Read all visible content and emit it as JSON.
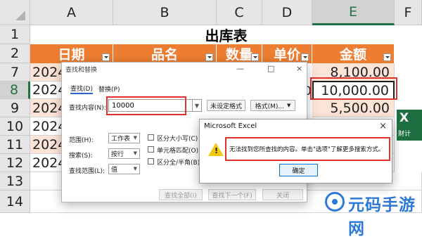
{
  "columns": [
    "A",
    "B",
    "C",
    "D",
    "E",
    "F"
  ],
  "selected_column": "E",
  "rows": [
    "1",
    "2",
    "7",
    "8",
    "9",
    "10",
    "11",
    "12",
    "13",
    "14"
  ],
  "selected_row": "8",
  "sheet_title": "出库表",
  "headers": [
    "日期",
    "品名",
    "数量",
    "单价",
    "金额"
  ],
  "date_cells": [
    "2024",
    "2024",
    "2024",
    "2024",
    "2024",
    "2024"
  ],
  "amounts": [
    "8,100.00",
    "10,000.00",
    "5,500.00"
  ],
  "partial_digit": "0",
  "colors": {
    "header_orange": "#ed7d31",
    "band_peach": "#fce4d6",
    "excel_green": "#217346",
    "highlight_red": "#e03030"
  },
  "find_dialog": {
    "title": "查找和替换",
    "tabs": [
      "查找(D)",
      "替换(P)"
    ],
    "find_label": "查找内容(N):",
    "find_value": "10000",
    "format_status": "未设定格式",
    "format_button": "格式(M)...",
    "scope_label": "范围(H):",
    "scope_value": "工作表",
    "search_label": "搜索(S):",
    "search_value": "按行",
    "lookin_label": "查找范围(L):",
    "lookin_value": "值",
    "options": [
      "区分大小写(C)",
      "单元格匹配(O)",
      "区分全/半角(B)"
    ],
    "buttons": [
      "查找全部(I)",
      "查找下一个(F)",
      "关闭"
    ],
    "window_controls": [
      "—",
      "□",
      "×"
    ]
  },
  "message_box": {
    "title": "Microsoft Excel",
    "text": "无法找到您所查找的内容。单击\"选项\"了解更多搜索方式。",
    "ok_label": "确定",
    "close": "×"
  },
  "excel_logo": {
    "letter": "X",
    "label": "财计"
  },
  "watermark": "元码手游网"
}
